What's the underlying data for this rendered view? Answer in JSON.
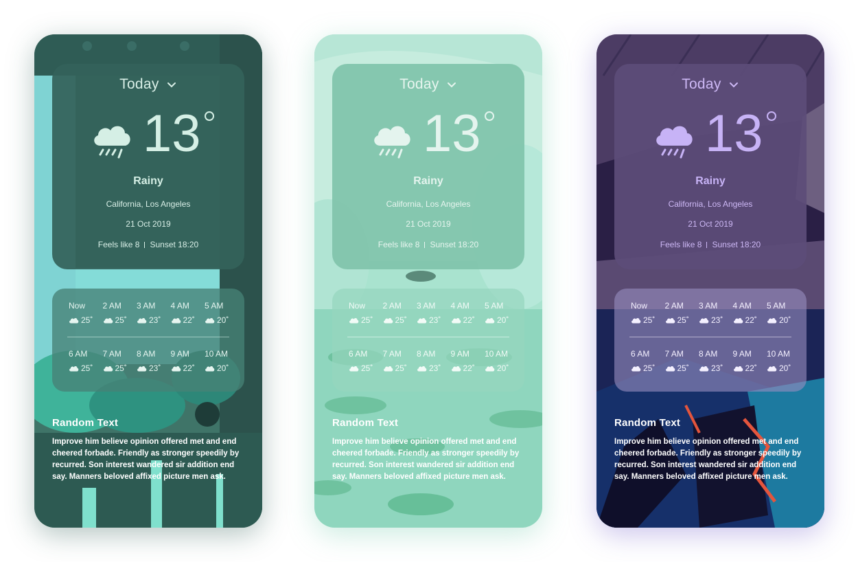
{
  "weather": {
    "period_label": "Today",
    "temperature": "13",
    "condition": "Rainy",
    "location": "California, Los Angeles",
    "date": "21 Oct 2019",
    "feels_like": "Feels like 8",
    "sunset": "Sunset 18:20",
    "icon": "cloud-rain-icon"
  },
  "hourly": [
    {
      "label": "Now",
      "temp": "25˚"
    },
    {
      "label": "2 AM",
      "temp": "25˚"
    },
    {
      "label": "3 AM",
      "temp": "23˚"
    },
    {
      "label": "4 AM",
      "temp": "22˚"
    },
    {
      "label": "5 AM",
      "temp": "20˚"
    },
    {
      "label": "6 AM",
      "temp": "25˚"
    },
    {
      "label": "7 AM",
      "temp": "25˚"
    },
    {
      "label": "8 AM",
      "temp": "23˚"
    },
    {
      "label": "9 AM",
      "temp": "22˚"
    },
    {
      "label": "10 AM",
      "temp": "20˚"
    }
  ],
  "text_section": {
    "title": "Random Text",
    "body": "Improve him believe opinion offered met and end cheered forbade. Friendly as stronger speedily by recurred. Son interest wandered sir addition end say. Manners beloved affixed picture men ask."
  },
  "themes": [
    {
      "name": "teal",
      "accent": "#d5efe5",
      "card": "#34625a"
    },
    {
      "name": "mint",
      "accent": "#e4f4ee",
      "card": "#80c4ab"
    },
    {
      "name": "purple",
      "accent": "#c7b3f6",
      "card": "#5c4c78"
    }
  ]
}
